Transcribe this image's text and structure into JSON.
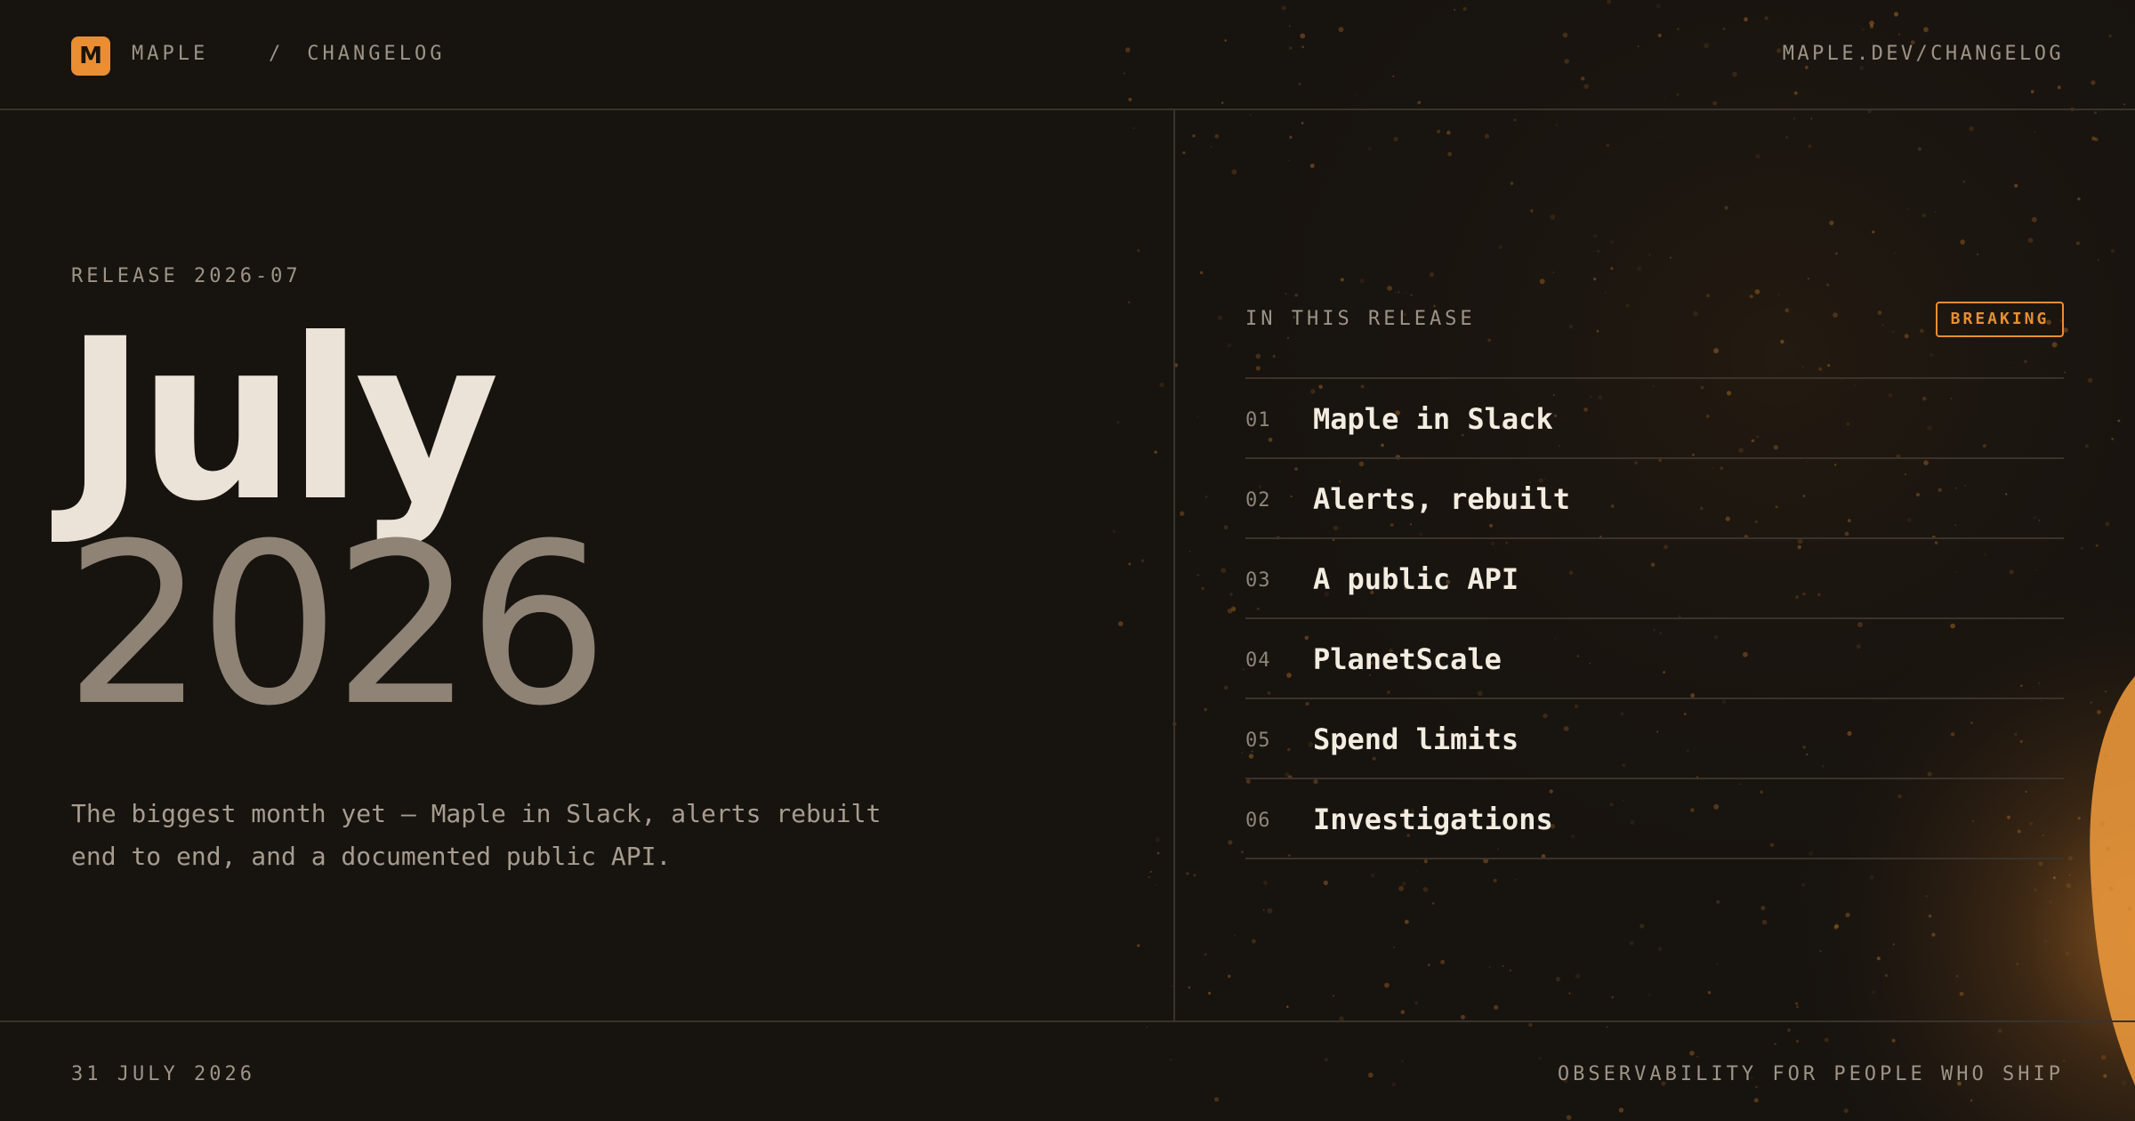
{
  "header": {
    "logo_letter": "M",
    "brand": "MAPLE",
    "separator": "/",
    "section": "CHANGELOG",
    "site_url": "MAPLE.DEV/CHANGELOG"
  },
  "hero": {
    "release_label": "RELEASE 2026-07",
    "month": "July",
    "year": "2026",
    "summary": "The biggest month yet — Maple in Slack, alerts rebuilt end to end, and a documented public API."
  },
  "release_panel": {
    "label": "IN THIS RELEASE",
    "badge": "BREAKING",
    "items": [
      {
        "num": "01",
        "label": "Maple in Slack"
      },
      {
        "num": "02",
        "label": "Alerts, rebuilt"
      },
      {
        "num": "03",
        "label": "A public API"
      },
      {
        "num": "04",
        "label": "PlanetScale"
      },
      {
        "num": "05",
        "label": "Spend limits"
      },
      {
        "num": "06",
        "label": "Investigations"
      }
    ]
  },
  "footer": {
    "date": "31 JULY 2026",
    "tagline": "OBSERVABILITY FOR PEOPLE WHO SHIP"
  },
  "colors": {
    "background": "#17130f",
    "accent": "#e98e33",
    "text_primary": "#efe7da",
    "text_muted": "#9d9487",
    "divider": "#3a332c"
  }
}
